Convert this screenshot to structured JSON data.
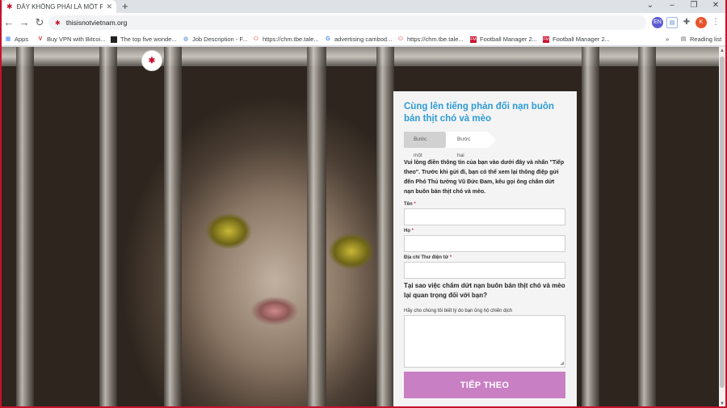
{
  "browser": {
    "tab_title": "ĐÂY KHÔNG PHẢI LÀ MỘT PHẢI...",
    "tab_favicon": "cat-favicon-icon",
    "url": "thisisnotvietnam.org",
    "new_tab": "+",
    "window_controls": {
      "minimize": "⌄",
      "restore": "–",
      "maximize": "❐",
      "close": "✕"
    },
    "profile_initial": "K",
    "extension_initial": "EN",
    "reading_list": "Reading list",
    "more_bookmarks": "»"
  },
  "bookmarks": [
    {
      "label": "Apps",
      "icon": "apps-grid-icon"
    },
    {
      "label": "Buy VPN with Bitcoi...",
      "icon": "vpn-icon"
    },
    {
      "label": "The top five wonde...",
      "icon": "page-icon"
    },
    {
      "label": "Job Description - F...",
      "icon": "globe-icon"
    },
    {
      "label": "https://chm.tbe.tale...",
      "icon": "ring-icon"
    },
    {
      "label": "advertising cambod...",
      "icon": "google-icon"
    },
    {
      "label": "https://chm.tbe.tale...",
      "icon": "ring-icon"
    },
    {
      "label": "Football Manager 2...",
      "icon": "fm-icon"
    },
    {
      "label": "Football Manager 2...",
      "icon": "fm-icon"
    }
  ],
  "page": {
    "logo_alt": "logo-icon"
  },
  "form": {
    "title": "Cùng lên tiếng phản đối nạn buôn bán thịt chó và mèo",
    "step1": "Bước một",
    "step2": "Bước hai",
    "intro": "Vui lòng điền thông tin của bạn vào dưới đây và nhấn \"Tiếp theo\". Trước khi gửi đi, bạn có thể xem lại thông điệp gửi đến Phó Thủ tướng Vũ Đức Đam, kêu gọi ông chấm dứt nạn buôn bán thịt chó và mèo.",
    "first_name_label": "Tên",
    "last_name_label": "Họ",
    "email_label": "Địa chỉ Thư điện tử",
    "required_mark": "*",
    "question": "Tại sao việc chấm dứt nạn buôn bán thịt chó và mèo lại quan trọng đối với bạn?",
    "reason_label": "Hãy cho chúng tôi biết lý do bạn ủng hộ chiến dịch",
    "submit": "TIẾP THEO",
    "accent_color": "#2e9bd6",
    "button_color": "#c87fc3"
  }
}
